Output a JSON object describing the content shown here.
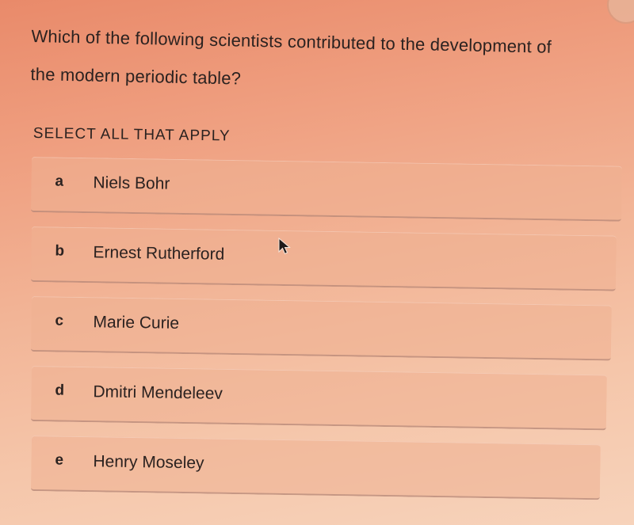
{
  "question": {
    "line1": "Which of the following scientists contributed to the development of",
    "line2": "the modern periodic table?"
  },
  "instruction": "SELECT ALL THAT APPLY",
  "options": [
    {
      "letter": "a",
      "text": "Niels Bohr"
    },
    {
      "letter": "b",
      "text": "Ernest Rutherford"
    },
    {
      "letter": "c",
      "text": "Marie Curie"
    },
    {
      "letter": "d",
      "text": "Dmitri Mendeleev"
    },
    {
      "letter": "e",
      "text": "Henry Moseley"
    }
  ],
  "cursor": {
    "icon": "arrow-pointer-icon"
  },
  "colors": {
    "background_top": "#e98a6a",
    "background_bottom": "#f7d3bb",
    "text": "#2b2220"
  }
}
